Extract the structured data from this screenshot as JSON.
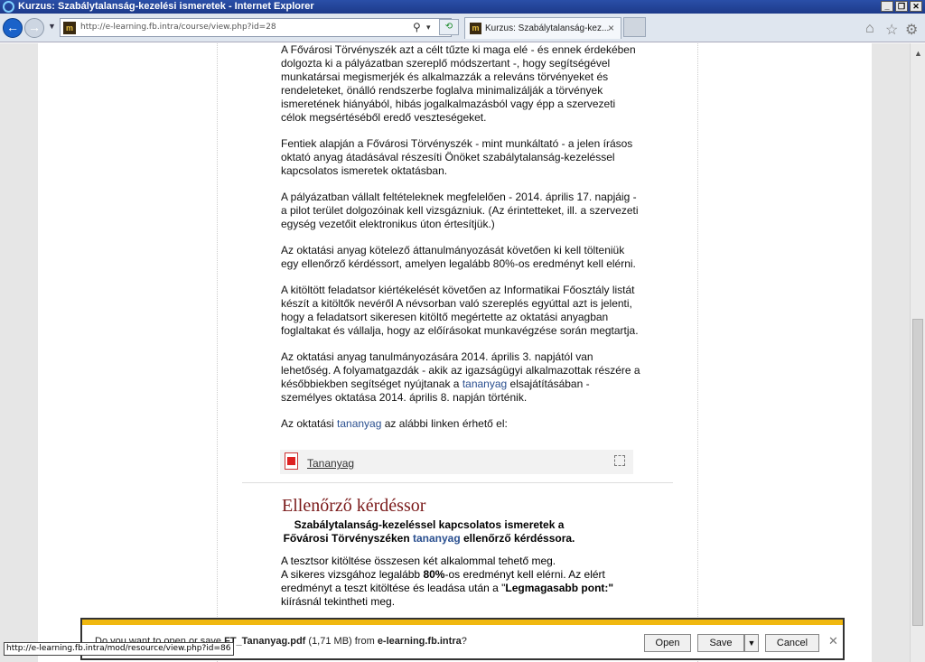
{
  "window": {
    "title": "Kurzus: Szabálytalanság-kezelési ismeretek - Internet Explorer",
    "controls": [
      "_",
      "❐",
      "✕"
    ]
  },
  "nav": {
    "url": "http://e-learning.fb.intra/course/view.php?id=28",
    "tab_title": "Kurzus: Szabálytalanság-kez...",
    "favicon_text": "m"
  },
  "content": {
    "paragraphs": [
      "A Fővárosi Törvényszék azt a célt tűzte ki maga elé - és ennek érdekében dolgozta ki a pályázatban szereplő módszertant -, hogy segítségével munkatársai megismerjék és alkalmazzák a releváns törvényeket és rendeleteket, önálló rendszerbe foglalva minimalizálják a törvények ismeretének hiányából, hibás jogalkalmazásból vagy épp a szervezeti célok megsértéséből eredő veszteségeket.",
      "Fentiek alapján a Fővárosi Törvényszék - mint munkáltató - a jelen írásos oktató anyag átadásával részesíti Önöket szabálytalanság-kezeléssel kapcsolatos ismeretek oktatásban.",
      "A pályázatban vállalt feltételeknek megfelelően - 2014. április 17. napjáig - a pilot terület dolgozóinak kell vizsgázniuk. (Az érintetteket, ill. a szervezeti egység vezetőit elektronikus úton értesítjük.)",
      "Az oktatási anyag kötelező áttanulmányozását követően ki kell tölteniük egy ellenőrző kérdéssort, amelyen legalább 80%-os eredményt kell elérni.",
      "A kitöltött feladatsor kiértékelését követően az Informatikai Főosztály listát készít a kitöltők nevéről A névsorban való szereplés egyúttal azt is jelenti, hogy a feladatsort sikeresen kitöltő megértette az oktatási anyagban foglaltakat és vállalja, hogy az előírásokat munkavégzése során megtartja."
    ],
    "p6_before": "Az oktatási anyag tanulmányozására 2014. április 3. napjától van lehetőség. A folyamatgazdák - akik az igazságügyi alkalmazottak részére a későbbiekben segítséget nyújtanak a ",
    "p6_link": "tananyag",
    "p6_after": " elsajátításában - személyes oktatása 2014. április 8. napján történik.",
    "p7_before": "Az oktatási ",
    "p7_link": "tananyag",
    "p7_after": " az alábbi linken érhető el:",
    "resource_label": "Tananyag",
    "section_title": "Ellenőrző kérdéssor",
    "quiz_intro_before": "Szabálytalanság-kezeléssel kapcsolatos ismeretek a Fővárosi Törvényszéken ",
    "quiz_intro_link": "tananyag",
    "quiz_intro_after": " ellenőrző kérdéssora.",
    "quiz_line1": "A tesztsor kitöltése összesen két alkalommal tehető meg.",
    "quiz_line2_before": "A sikeres vizsgához legalább ",
    "quiz_line2_bold": "80%",
    "quiz_line2_after": "-os eredményt kell elérni. Az elért eredményt a teszt kitöltése és leadása után a \"",
    "quiz_line2_bold2": "Legmagasabb pont:\"",
    "quiz_line3": "kiírásnál tekintheti meg."
  },
  "download": {
    "prompt": "Do you want to open or save ",
    "filename": "FT_Tananyag.pdf",
    "size": " (1,71 MB) from ",
    "host": "e-learning.fb.intra",
    "suffix": "?",
    "open_label": "Open",
    "save_label": "Save",
    "cancel_label": "Cancel"
  },
  "status": {
    "hover_url": "http://e-learning.fb.intra/mod/resource/view.php?id=86"
  },
  "colors": {
    "accent": "#f0b810",
    "section_title": "#7a1a1a",
    "link": "#2a4f8f"
  }
}
